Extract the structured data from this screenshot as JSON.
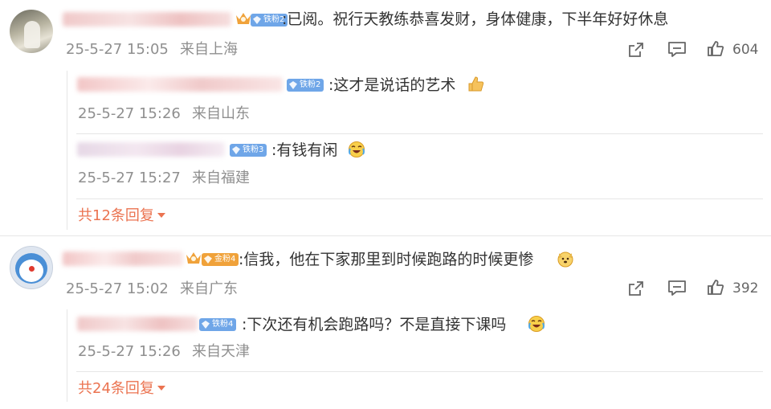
{
  "comments": [
    {
      "badge": "铁粉2",
      "text": ":已阅。祝行天教练恭喜发财，身体健康，下半年好好休息",
      "time": "25-5-27 15:05",
      "location": "来自上海",
      "likes": "604",
      "replies": [
        {
          "badge": "铁粉2",
          "text": ":这才是说话的艺术",
          "emoji": "thumbs-up",
          "time": "25-5-27 15:26",
          "location": "来自山东"
        },
        {
          "badge": "铁粉3",
          "text": ":有钱有闲",
          "emoji": "crying-laughing",
          "time": "25-5-27 15:27",
          "location": "来自福建"
        }
      ],
      "more_replies": "共12条回复"
    },
    {
      "badge": "金粉4",
      "text": ":信我，他在下家那里到时候跑路的时候更惨",
      "emoji": "dog-face",
      "time": "25-5-27 15:02",
      "location": "来自广东",
      "likes": "392",
      "replies": [
        {
          "badge": "铁粉4",
          "text": ":下次还有机会跑路吗？不是直接下课吗",
          "emoji": "crying-laughing",
          "time": "25-5-27 15:26",
          "location": "来自天津"
        }
      ],
      "more_replies": "共24条回复"
    }
  ],
  "colors": {
    "link": "#eb7350",
    "meta": "#8f8f8f",
    "badge_blue": "#6fa6e8",
    "badge_gold": "#f0a23a"
  }
}
